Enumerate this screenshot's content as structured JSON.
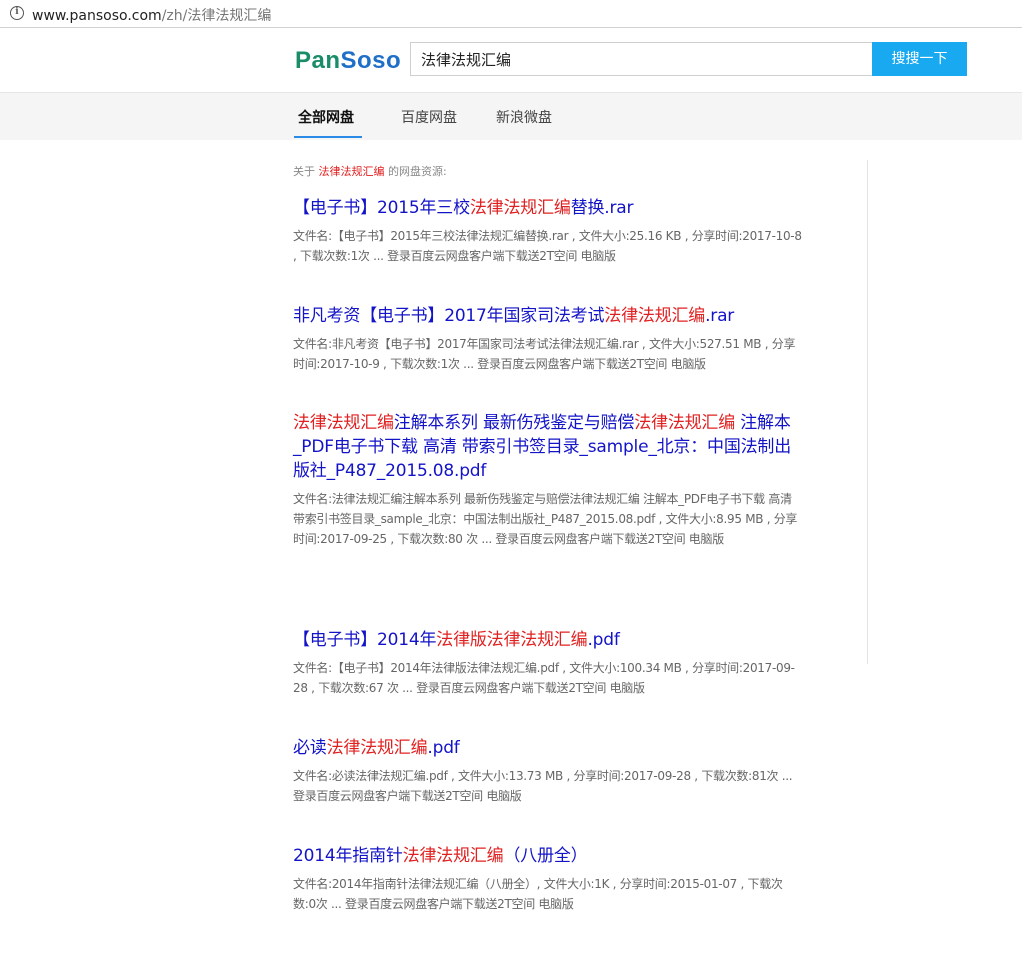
{
  "browser": {
    "url_host": "www.pansoso.com",
    "url_path": "/zh/法律法规汇编"
  },
  "header": {
    "logo_pan": "Pan",
    "logo_soso": "Soso",
    "search_value": "法律法规汇编",
    "search_button": "搜搜一下"
  },
  "tabs": [
    {
      "label": "全部网盘",
      "active": true
    },
    {
      "label": "百度网盘",
      "active": false
    },
    {
      "label": "新浪微盘",
      "active": false
    }
  ],
  "about": {
    "prefix": "关于",
    "keyword": "法律法规汇编",
    "suffix": "的网盘资源:"
  },
  "colors": {
    "link": "#1313c8",
    "highlight": "#e02020",
    "button": "#19a9f0"
  },
  "results": [
    {
      "title_parts": [
        {
          "text": "【电子书】2015年三校",
          "hl": false
        },
        {
          "text": "法律法规汇编",
          "hl": true
        },
        {
          "text": "替换.rar",
          "hl": false
        }
      ],
      "desc": "文件名:【电子书】2015年三校法律法规汇编替换.rar , 文件大小:25.16 KB , 分享时间:2017-10-8 , 下载次数:1次 ... 登录百度云网盘客户端下载送2T空间 电脑版"
    },
    {
      "title_parts": [
        {
          "text": "非凡考资【电子书】2017年国家司法考试",
          "hl": false
        },
        {
          "text": "法律法规汇编",
          "hl": true
        },
        {
          "text": ".rar",
          "hl": false
        }
      ],
      "desc": "文件名:非凡考资【电子书】2017年国家司法考试法律法规汇编.rar , 文件大小:527.51 MB , 分享时间:2017-10-9 , 下载次数:1次 ... 登录百度云网盘客户端下载送2T空间 电脑版"
    },
    {
      "title_parts": [
        {
          "text": "法律法规汇编",
          "hl": true
        },
        {
          "text": "注解本系列 最新伤残鉴定与赔偿",
          "hl": false
        },
        {
          "text": "法律法规汇编",
          "hl": true
        },
        {
          "text": " 注解本_PDF电子书下载 高清 带索引书签目录_sample_北京：中国法制出版社_P487_2015.08.pdf",
          "hl": false
        }
      ],
      "desc": "文件名:法律法规汇编注解本系列 最新伤残鉴定与赔偿法律法规汇编 注解本_PDF电子书下载 高清 带索引书签目录_sample_北京：中国法制出版社_P487_2015.08.pdf , 文件大小:8.95 MB , 分享时间:2017-09-25 , 下载次数:80 次 ... 登录百度云网盘客户端下载送2T空间 电脑版"
    },
    {
      "title_parts": [
        {
          "text": "【电子书】2014年",
          "hl": false
        },
        {
          "text": "法律版法律法规汇编",
          "hl": true
        },
        {
          "text": ".pdf",
          "hl": false
        }
      ],
      "desc": "文件名:【电子书】2014年法律版法律法规汇编.pdf , 文件大小:100.34 MB , 分享时间:2017-09-28 , 下载次数:67 次 ... 登录百度云网盘客户端下载送2T空间 电脑版"
    },
    {
      "title_parts": [
        {
          "text": "必读",
          "hl": false
        },
        {
          "text": "法律法规汇编",
          "hl": true
        },
        {
          "text": ".pdf",
          "hl": false
        }
      ],
      "desc": "文件名:必读法律法规汇编.pdf , 文件大小:13.73 MB , 分享时间:2017-09-28 , 下载次数:81次 ... 登录百度云网盘客户端下载送2T空间 电脑版"
    },
    {
      "title_parts": [
        {
          "text": "2014年指南针",
          "hl": false
        },
        {
          "text": "法律法规汇编",
          "hl": true
        },
        {
          "text": "（八册全）",
          "hl": false
        }
      ],
      "desc": "文件名:2014年指南针法律法规汇编（八册全）, 文件大小:1K , 分享时间:2015-01-07 , 下载次数:0次 ... 登录百度云网盘客户端下载送2T空间 电脑版"
    }
  ]
}
